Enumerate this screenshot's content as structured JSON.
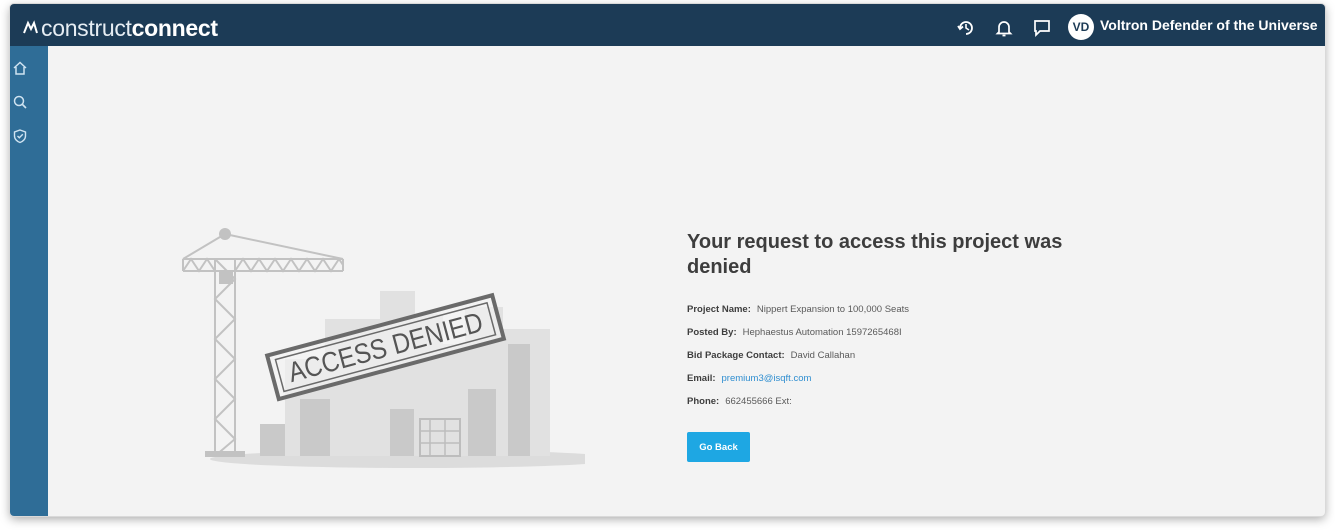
{
  "header": {
    "logo_light": "construct",
    "logo_bold": "connect",
    "icons": [
      "history-icon",
      "bell-icon",
      "chat-icon"
    ],
    "avatar_initials": "VD",
    "user_name": "Voltron Defender of the Universe"
  },
  "sidebar": {
    "icons": [
      "home-icon",
      "search-icon",
      "shield-icon"
    ]
  },
  "illustration": {
    "stamp_text": "ACCESS DENIED"
  },
  "main": {
    "title": "Your request to access this project was denied",
    "details": {
      "project_name_label": "Project Name:",
      "project_name": "Nippert Expansion to 100,000 Seats",
      "posted_by_label": "Posted By:",
      "posted_by": "Hephaestus Automation 1597265468I",
      "contact_label": "Bid Package Contact:",
      "contact": "David Callahan",
      "email_label": "Email:",
      "email": "premium3@isqft.com",
      "phone_label": "Phone:",
      "phone": "662455666 Ext:"
    },
    "go_back_label": "Go Back"
  },
  "colors": {
    "topbar": "#1c3b56",
    "sidebar": "#2f6d97",
    "background": "#f3f3f3",
    "accent": "#1ea7e3",
    "link": "#2f8ed0"
  }
}
